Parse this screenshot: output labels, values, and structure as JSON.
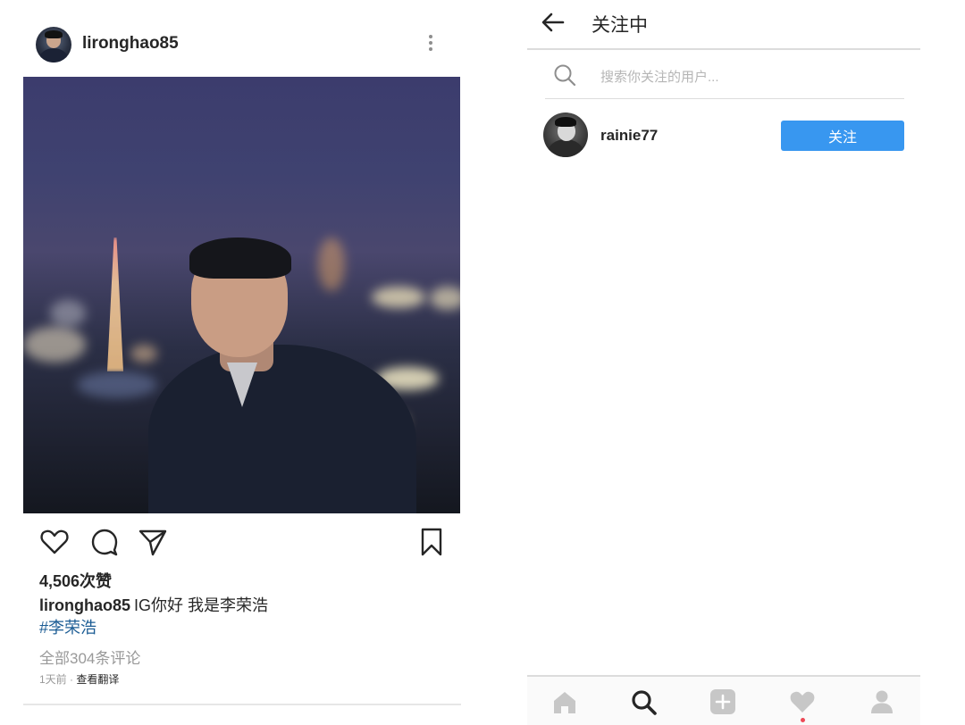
{
  "post": {
    "username": "lironghao85",
    "likes_text": "4,506次赞",
    "caption_user": "lironghao85",
    "caption_text": "IG你好 我是李荣浩",
    "hashtag": "#李荣浩",
    "comments_text": "全部304条评论",
    "time_text": "1天前 · ",
    "translate_label": "查看翻译"
  },
  "following": {
    "title": "关注中",
    "search_placeholder": "搜索你关注的用户...",
    "users": [
      {
        "username": "rainie77",
        "button_label": "关注"
      }
    ]
  },
  "bottom_nav": [
    "home-icon",
    "search-icon",
    "add-icon",
    "heart-icon",
    "profile-icon"
  ],
  "colors": {
    "accent": "#3897f0",
    "hashtag": "#1b5c94",
    "muted_text": "#999999",
    "notification_dot": "#ed4956"
  }
}
